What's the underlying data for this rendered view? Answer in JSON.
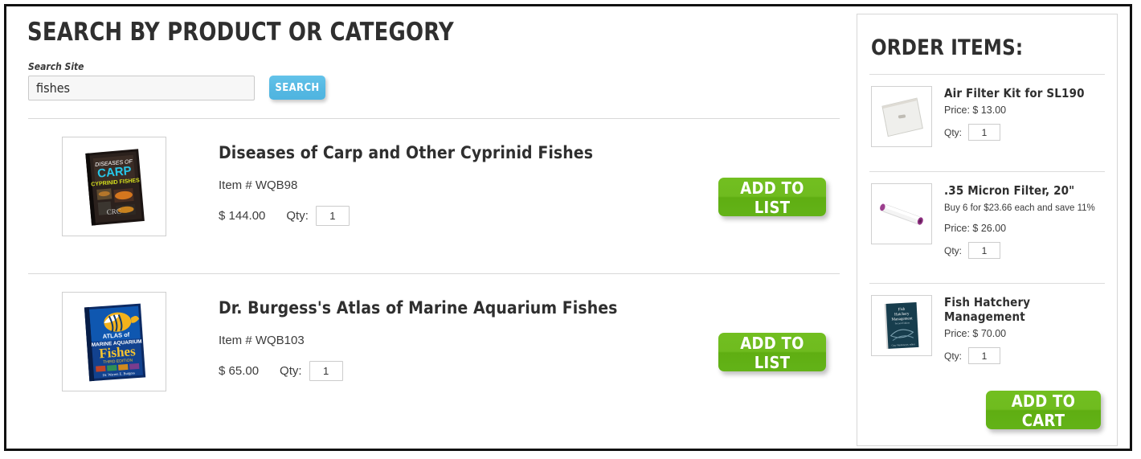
{
  "main": {
    "title": "Search by Product or Category",
    "search": {
      "label": "Search Site",
      "value": "fishes",
      "placeholder": "",
      "button_label": "Search"
    },
    "results": [
      {
        "title": "Diseases of Carp and Other Cyprinid Fishes",
        "item_number": "Item # WQB98",
        "price": "$ 144.00",
        "qty_label": "Qty:",
        "qty_value": "1",
        "button_label": "Add to List",
        "thumb": "book-cover-diseases-of-carp"
      },
      {
        "title": "Dr. Burgess's Atlas of Marine Aquarium Fishes",
        "item_number": "Item # WQB103",
        "price": "$ 65.00",
        "qty_label": "Qty:",
        "qty_value": "1",
        "button_label": "Add to List",
        "thumb": "book-cover-atlas-of-marine-aquarium-fishes"
      }
    ]
  },
  "sidebar": {
    "title": "Order Items:",
    "items": [
      {
        "name": "Air Filter Kit for SL190",
        "promo": "",
        "price": "Price: $ 13.00",
        "qty_label": "Qty:",
        "qty_value": "1",
        "thumb": "air-filter-pad"
      },
      {
        "name": ".35 Micron Filter, 20\"",
        "promo": "Buy 6 for $23.66 each and save 11%",
        "price": "Price: $ 26.00",
        "qty_label": "Qty:",
        "qty_value": "1",
        "thumb": "micron-filter-cartridge"
      },
      {
        "name": "Fish Hatchery Management",
        "promo": "",
        "price": "Price: $ 70.00",
        "qty_label": "Qty:",
        "qty_value": "1",
        "thumb": "book-cover-fish-hatchery-management"
      }
    ],
    "add_to_cart_label": "Add to Cart"
  },
  "colors": {
    "accent_green": "#6ab81c",
    "accent_blue": "#55b8e2",
    "text_dark": "#2f2f2f",
    "border_grey": "#d6d6d6",
    "frame_black": "#111111"
  }
}
